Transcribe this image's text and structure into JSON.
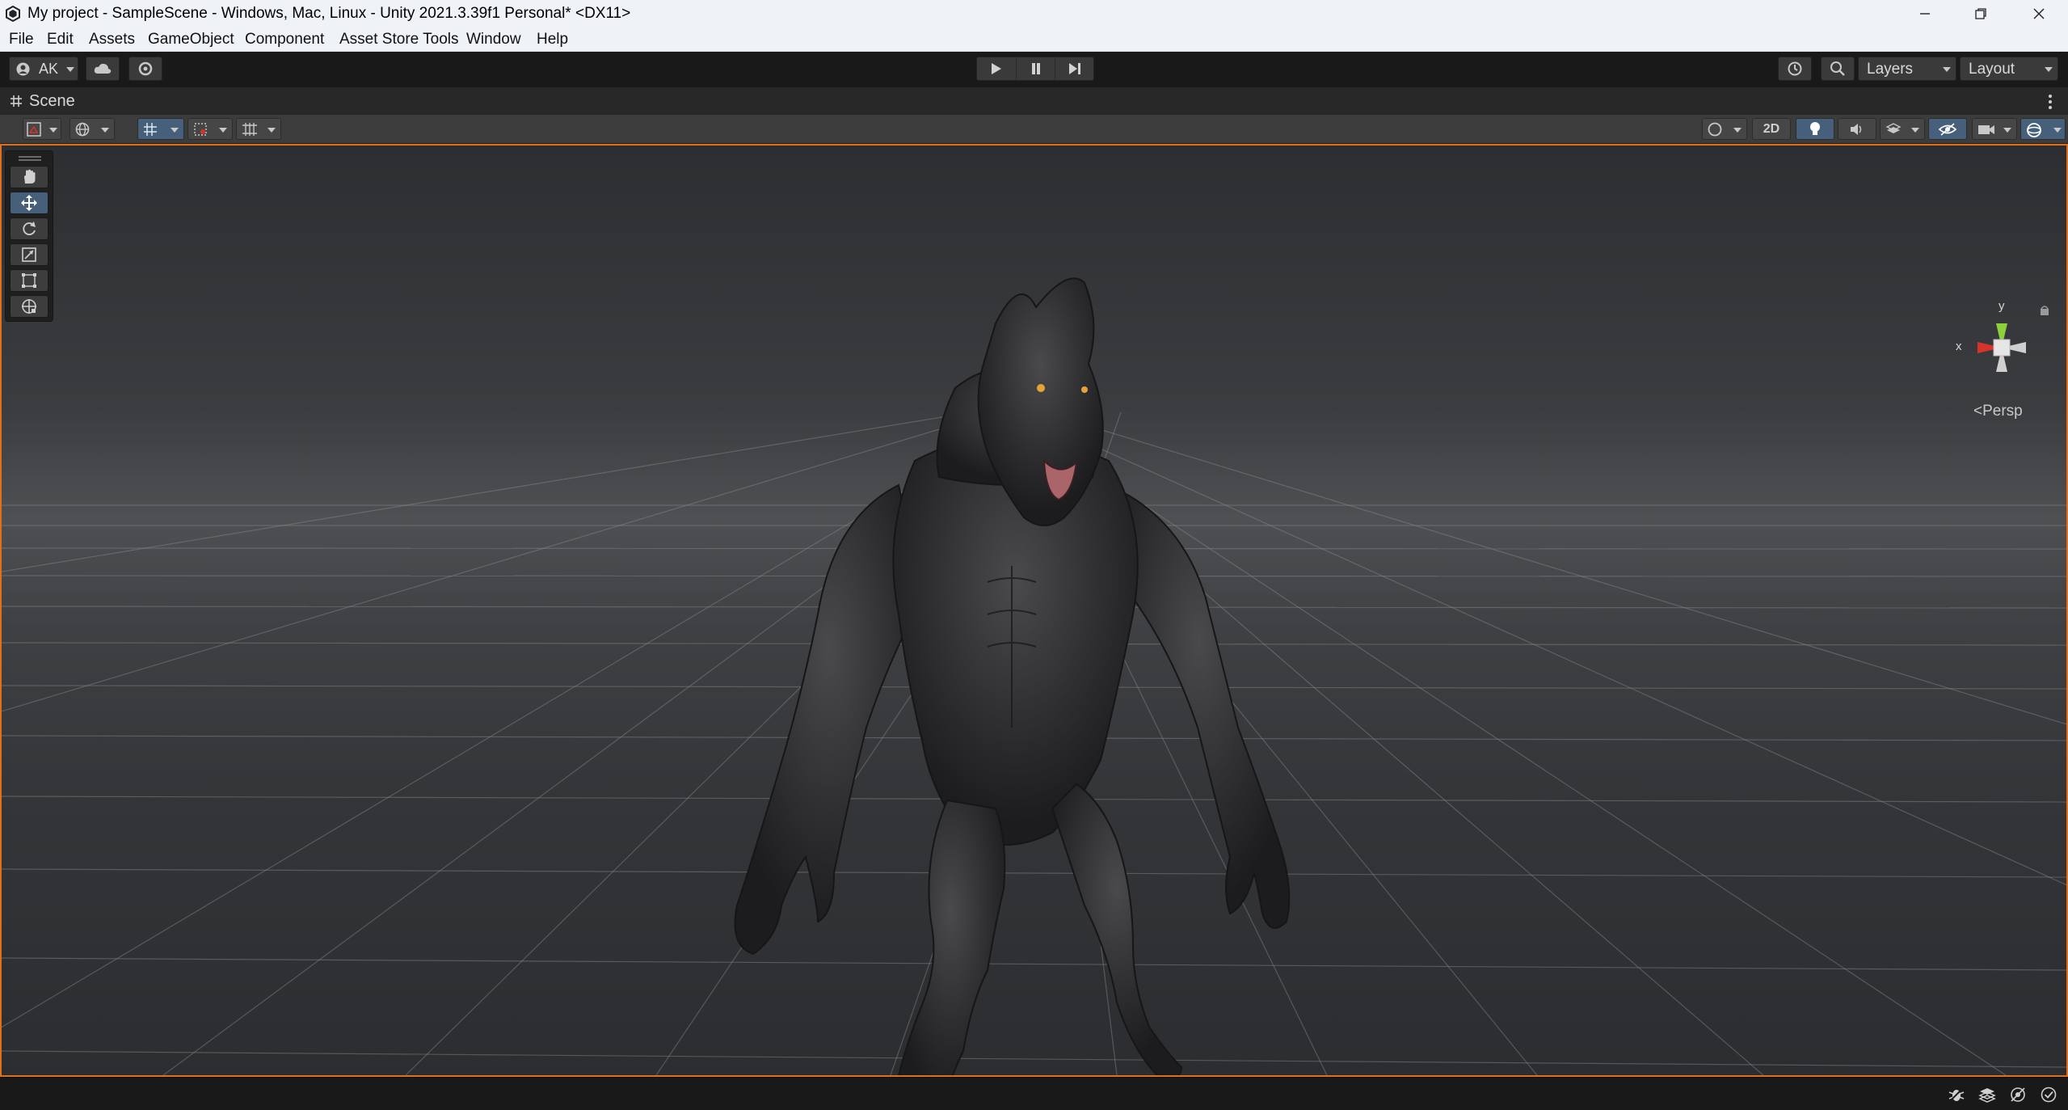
{
  "window": {
    "title": "My project - SampleScene - Windows, Mac, Linux - Unity 2021.3.39f1 Personal* <DX11>",
    "controls": [
      "minimize-icon",
      "restore-icon",
      "close-icon"
    ]
  },
  "menu": {
    "items": [
      "File",
      "Edit",
      "Assets",
      "GameObject",
      "Component",
      "Asset Store Tools",
      "Window",
      "Help"
    ]
  },
  "toolbar": {
    "account_label": "AK",
    "layers_label": "Layers",
    "layout_label": "Layout",
    "play_controls": [
      "play-icon",
      "pause-icon",
      "step-icon"
    ]
  },
  "scene_tab": {
    "label": "Scene"
  },
  "scene_toolbar": {
    "mode_2d_label": "2D",
    "lighting_enabled": true,
    "hidden_objects_toggle_active": true
  },
  "tools": [
    {
      "name": "hand-tool",
      "active": false
    },
    {
      "name": "move-tool",
      "active": true
    },
    {
      "name": "rotate-tool",
      "active": false
    },
    {
      "name": "scale-tool",
      "active": false
    },
    {
      "name": "rect-tool",
      "active": false
    },
    {
      "name": "transform-tool",
      "active": false
    }
  ],
  "gizmo": {
    "y_label": "y",
    "x_label": "x",
    "projection_label": "Persp"
  },
  "colors": {
    "accent_orange": "#e0701b",
    "active_button": "#46607c",
    "axis_x": "#d7332a",
    "axis_y": "#8cd13b"
  }
}
